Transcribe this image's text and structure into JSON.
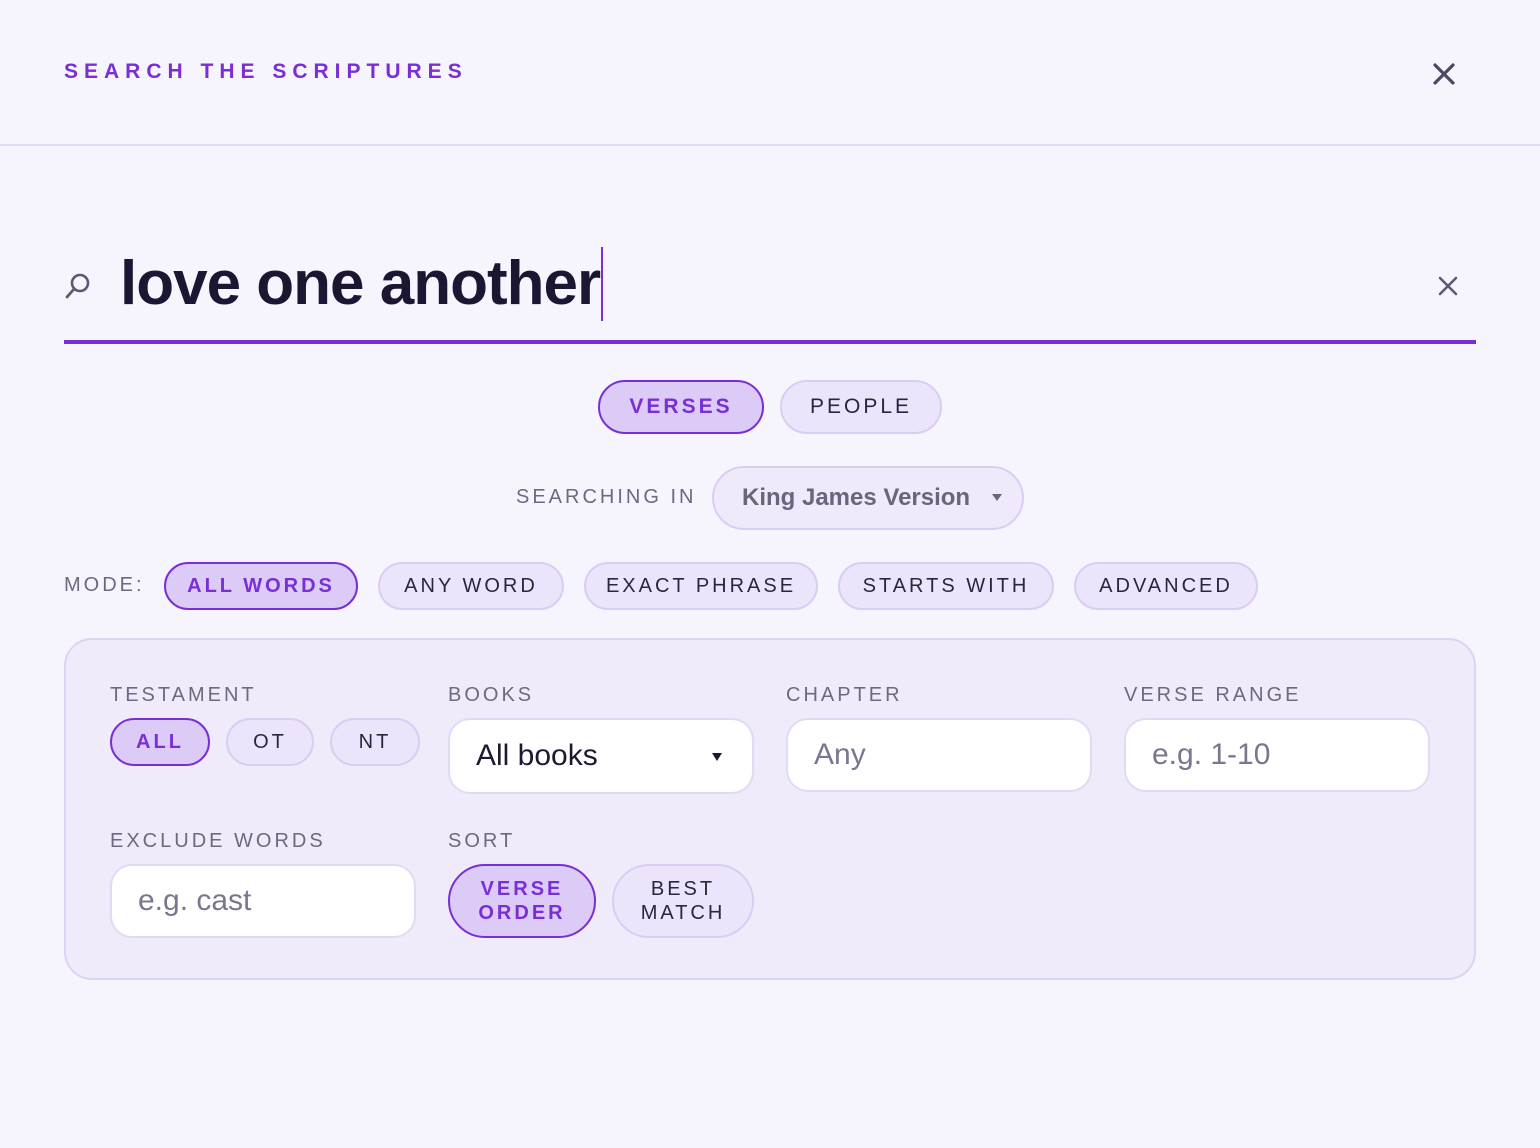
{
  "header": {
    "title": "SEARCH THE SCRIPTURES"
  },
  "search": {
    "query": "love one another"
  },
  "tabs": [
    {
      "label": "VERSES",
      "active": true
    },
    {
      "label": "PEOPLE",
      "active": false
    }
  ],
  "scope": {
    "label": "SEARCHING IN",
    "version": "King James Version"
  },
  "mode": {
    "label": "MODE:",
    "options": [
      {
        "label": "ALL WORDS",
        "active": true
      },
      {
        "label": "ANY WORD",
        "active": false
      },
      {
        "label": "EXACT PHRASE",
        "active": false
      },
      {
        "label": "STARTS WITH",
        "active": false
      },
      {
        "label": "ADVANCED",
        "active": false
      }
    ]
  },
  "filters": {
    "testament": {
      "label": "TESTAMENT",
      "options": [
        {
          "label": "ALL",
          "active": true
        },
        {
          "label": "OT",
          "active": false
        },
        {
          "label": "NT",
          "active": false
        }
      ]
    },
    "books": {
      "label": "BOOKS",
      "value": "All books"
    },
    "chapter": {
      "label": "CHAPTER",
      "placeholder": "Any"
    },
    "verse_range": {
      "label": "VERSE RANGE",
      "placeholder": "e.g. 1-10"
    },
    "exclude": {
      "label": "EXCLUDE WORDS",
      "placeholder": "e.g. cast"
    },
    "sort": {
      "label": "SORT",
      "options": [
        {
          "label_line1": "VERSE",
          "label_line2": "ORDER",
          "active": true
        },
        {
          "label_line1": "BEST",
          "label_line2": "MATCH",
          "active": false
        }
      ]
    }
  },
  "colors": {
    "accent": "#7a2fd6",
    "background": "#f6f4fd",
    "panel": "#efebfa"
  }
}
